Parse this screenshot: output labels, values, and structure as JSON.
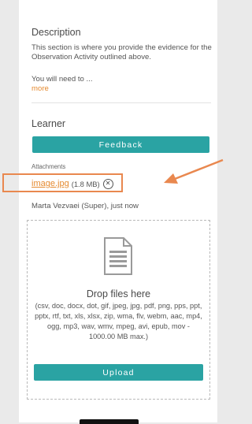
{
  "description": {
    "title": "Description",
    "body": "This section is where you provide the evidence for the Observation Activity outlined above.",
    "need": "You will need to ...",
    "more": "more"
  },
  "learner": {
    "title": "Learner",
    "feedback_label": "Feedback"
  },
  "attachments": {
    "label": "Attachments",
    "file_name": "image.jpg",
    "file_size": "(1.8 MB)",
    "remove_symbol": "✕",
    "uploaded_by": "Marta Vezvaei (Super), just now"
  },
  "dropzone": {
    "icon": "document-icon",
    "title": "Drop files here",
    "formats": "(csv, doc, docx, dot, gif, jpeg, jpg, pdf, png, pps, ppt, pptx, rtf, txt, xls, xlsx, zip, wma, flv, webm, aac, mp4, ogg, mp3, wav, wmv, mpeg, avi, epub, mov - 1000.00 MB max.)",
    "upload_label": "Upload"
  },
  "colors": {
    "accent": "#2aa3a3",
    "link": "#e58a2f",
    "annotation": "#e9884f"
  }
}
